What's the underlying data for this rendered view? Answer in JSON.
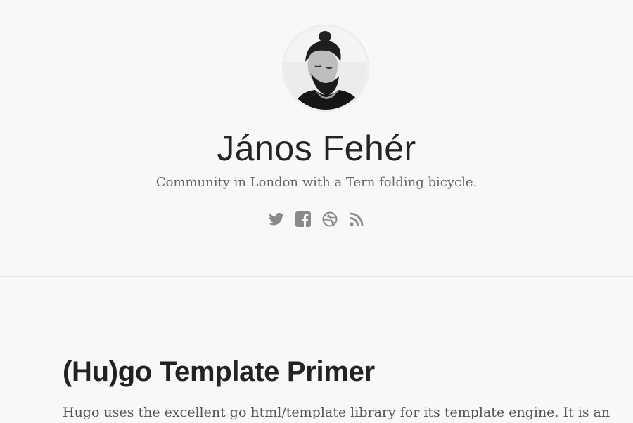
{
  "profile": {
    "name": "János Fehér",
    "tagline": "Community in London with a Tern folding bicycle.",
    "avatar_icon": "bearded-man-portrait"
  },
  "social": [
    {
      "icon": "twitter-icon",
      "label": "Twitter"
    },
    {
      "icon": "facebook-icon",
      "label": "Facebook"
    },
    {
      "icon": "dribbble-icon",
      "label": "Dribbble"
    },
    {
      "icon": "rss-icon",
      "label": "RSS"
    }
  ],
  "post": {
    "title": "(Hu)go Template Primer",
    "excerpt": "Hugo uses the excellent go html/template library for its template engine. It is an"
  },
  "colors": {
    "background": "#f8f8f8",
    "divider": "#e6e6e6",
    "heading": "#242424",
    "text": "#555555",
    "icon": "#8a8a8a"
  }
}
